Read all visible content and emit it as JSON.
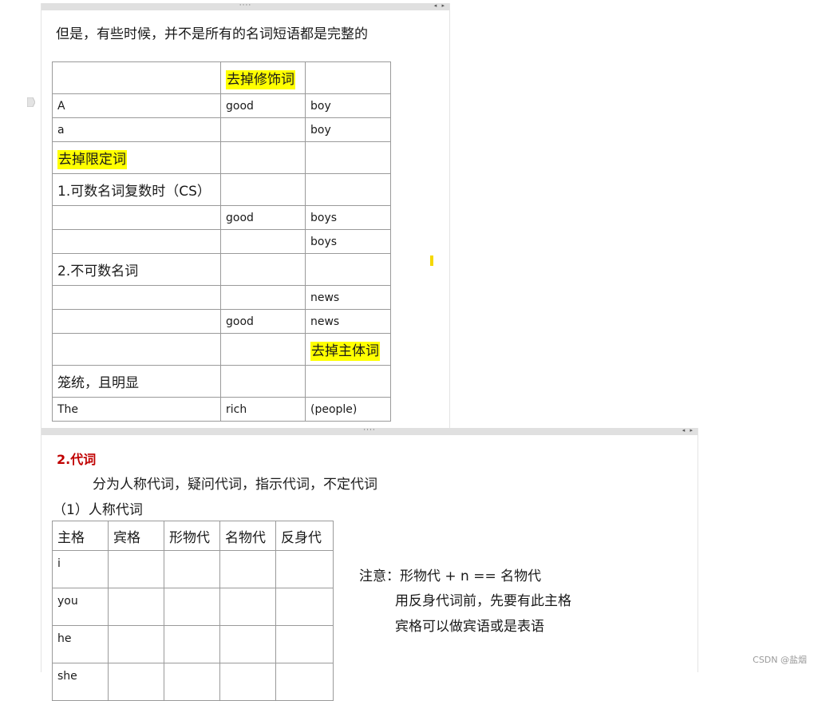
{
  "panel1": {
    "intro": "但是，有些时候，并不是所有的名词短语都是完整的",
    "rows": [
      [
        "",
        "去掉修饰词",
        ""
      ],
      [
        "A",
        "good",
        "boy"
      ],
      [
        "a",
        "",
        "boy"
      ],
      [
        "去掉限定词",
        "",
        ""
      ],
      [
        "1.可数名词复数时（CS）",
        "",
        ""
      ],
      [
        "",
        "good",
        "boys"
      ],
      [
        "",
        "",
        "boys"
      ],
      [
        "2.不可数名词",
        "",
        ""
      ],
      [
        "",
        "",
        "news"
      ],
      [
        "",
        "good",
        "news"
      ],
      [
        "",
        "",
        "去掉主体词"
      ],
      [
        "笼统，且明显",
        "",
        ""
      ],
      [
        "The",
        "rich",
        "(people)"
      ]
    ]
  },
  "panel2": {
    "section_title": "2.代词",
    "summary": "分为人称代词，疑问代词，指示代词，不定代词",
    "sub_title": "（1）人称代词",
    "headers": [
      "主格",
      "宾格",
      "形物代",
      "名物代",
      "反身代"
    ],
    "rows": [
      "i",
      "you",
      "he",
      "she"
    ],
    "notes": [
      "注意：形物代 + n == 名物代",
      "用反身代词前，先要有此主格",
      "宾格可以做宾语或是表语"
    ]
  },
  "toolbar": {
    "grip": "····",
    "arrows": "◂ ▸"
  },
  "watermark": "CSDN @盐烟",
  "colors": {
    "highlight": "#ffff00",
    "section_title": "#c00000",
    "panel_bar": "#e0e0e0"
  }
}
